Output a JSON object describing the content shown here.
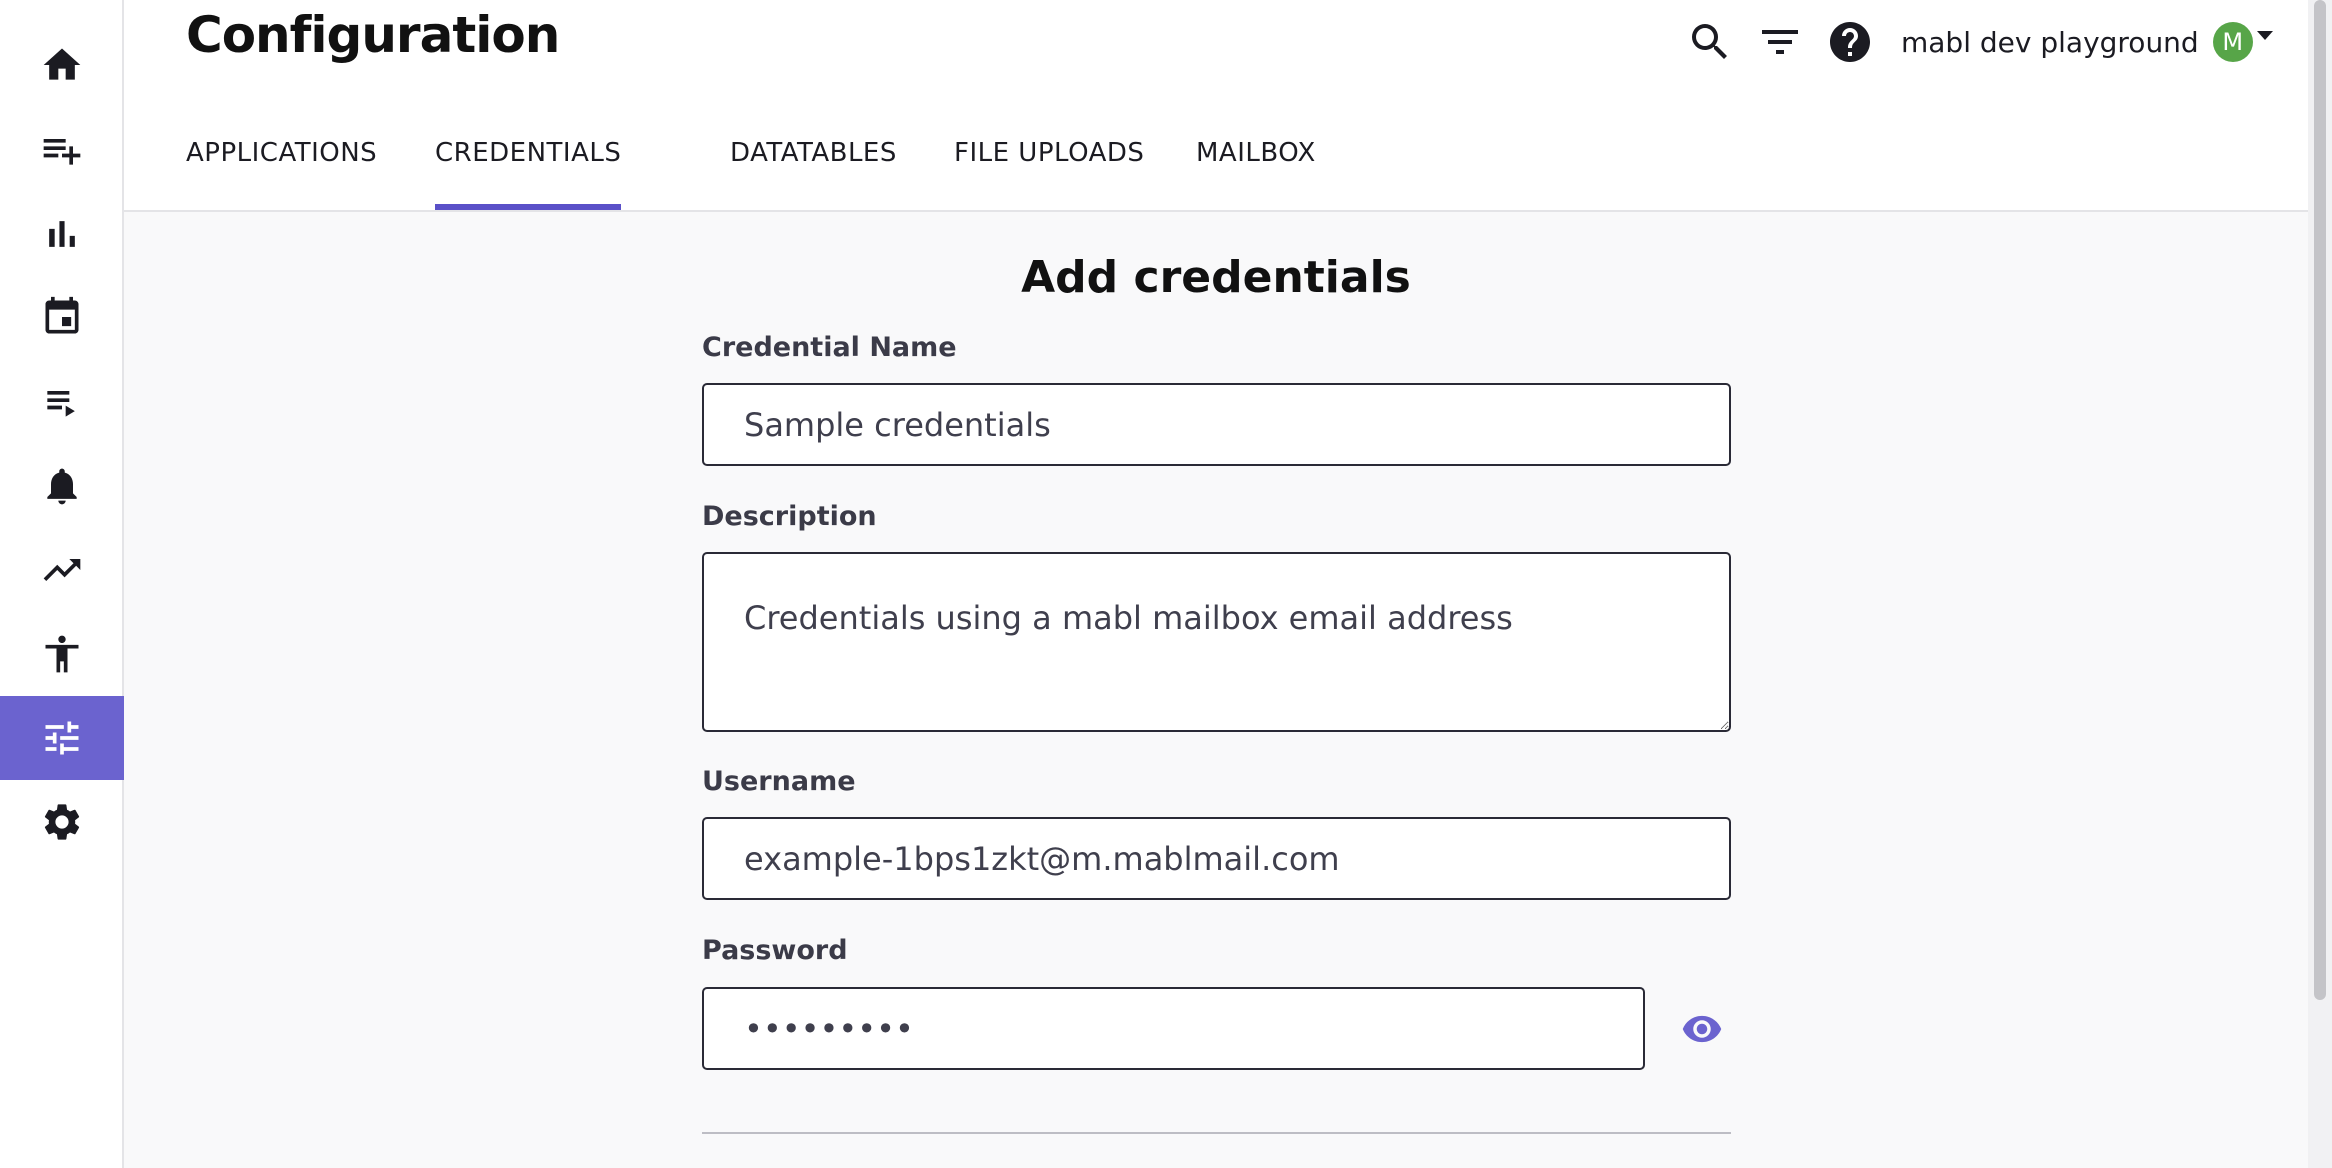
{
  "header": {
    "title": "Configuration",
    "workspace": "mabl dev playground",
    "avatar_initial": "M"
  },
  "sidebar": {
    "items": [
      {
        "name": "home",
        "icon": "home-icon"
      },
      {
        "name": "create",
        "icon": "playlist-add-icon"
      },
      {
        "name": "results",
        "icon": "bar-chart-icon"
      },
      {
        "name": "schedule",
        "icon": "calendar-icon"
      },
      {
        "name": "plans",
        "icon": "playlist-play-icon"
      },
      {
        "name": "notifications",
        "icon": "bell-icon"
      },
      {
        "name": "insights",
        "icon": "trending-up-icon"
      },
      {
        "name": "accessibility",
        "icon": "accessibility-icon"
      },
      {
        "name": "configuration",
        "icon": "tune-icon",
        "active": true
      },
      {
        "name": "settings",
        "icon": "gear-icon"
      }
    ]
  },
  "tabs": [
    {
      "label": "APPLICATIONS"
    },
    {
      "label": "CREDENTIALS",
      "active": true
    },
    {
      "label": "DATATABLES"
    },
    {
      "label": "FILE UPLOADS"
    },
    {
      "label": "MAILBOX"
    }
  ],
  "form": {
    "title": "Add credentials",
    "name_label": "Credential Name",
    "name_value": "Sample credentials",
    "description_label": "Description",
    "description_value": "Credentials using a mabl mailbox email address",
    "username_label": "Username",
    "username_value": "example-1bps1zkt@m.mablmail.com",
    "password_label": "Password",
    "password_value": "secretpwd"
  },
  "colors": {
    "accent": "#6b63cf",
    "tab_underline": "#5a50c8",
    "avatar": "#57a548"
  }
}
